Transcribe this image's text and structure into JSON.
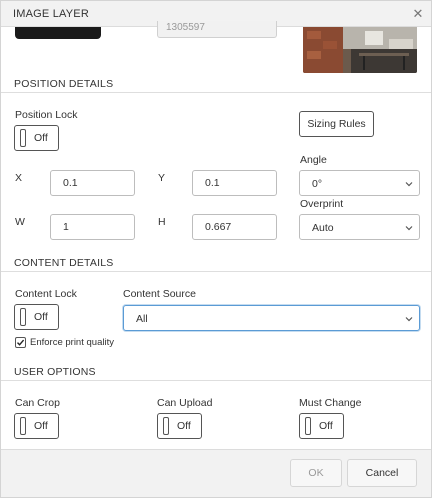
{
  "dialog": {
    "title": "IMAGE LAYER"
  },
  "top": {
    "id_value": "1305597"
  },
  "position": {
    "header": "POSITION DETAILS",
    "lock_label": "Position Lock",
    "lock_state": "Off",
    "sizing_rules_label": "Sizing Rules",
    "x_label": "X",
    "x_value": "0.1",
    "y_label": "Y",
    "y_value": "0.1",
    "w_label": "W",
    "w_value": "1",
    "h_label": "H",
    "h_value": "0.667",
    "angle_label": "Angle",
    "angle_value": "0°",
    "overprint_label": "Overprint",
    "overprint_value": "Auto"
  },
  "content": {
    "header": "CONTENT DETAILS",
    "lock_label": "Content Lock",
    "lock_state": "Off",
    "source_label": "Content Source",
    "source_value": "All",
    "enforce_label": "Enforce print quality",
    "enforce_checked": true
  },
  "user_options": {
    "header": "USER OPTIONS",
    "can_crop_label": "Can Crop",
    "can_crop_state": "Off",
    "can_upload_label": "Can Upload",
    "can_upload_state": "Off",
    "must_change_label": "Must Change",
    "must_change_state": "Off"
  },
  "footer": {
    "ok_label": "OK",
    "cancel_label": "Cancel"
  },
  "colors": {
    "accent_focus": "#5b9bd5",
    "header_bg": "#f2f2f2",
    "text": "#333333"
  },
  "icons": {
    "close": "close-icon",
    "chevron": "chevron-down-icon",
    "check": "check-icon"
  }
}
